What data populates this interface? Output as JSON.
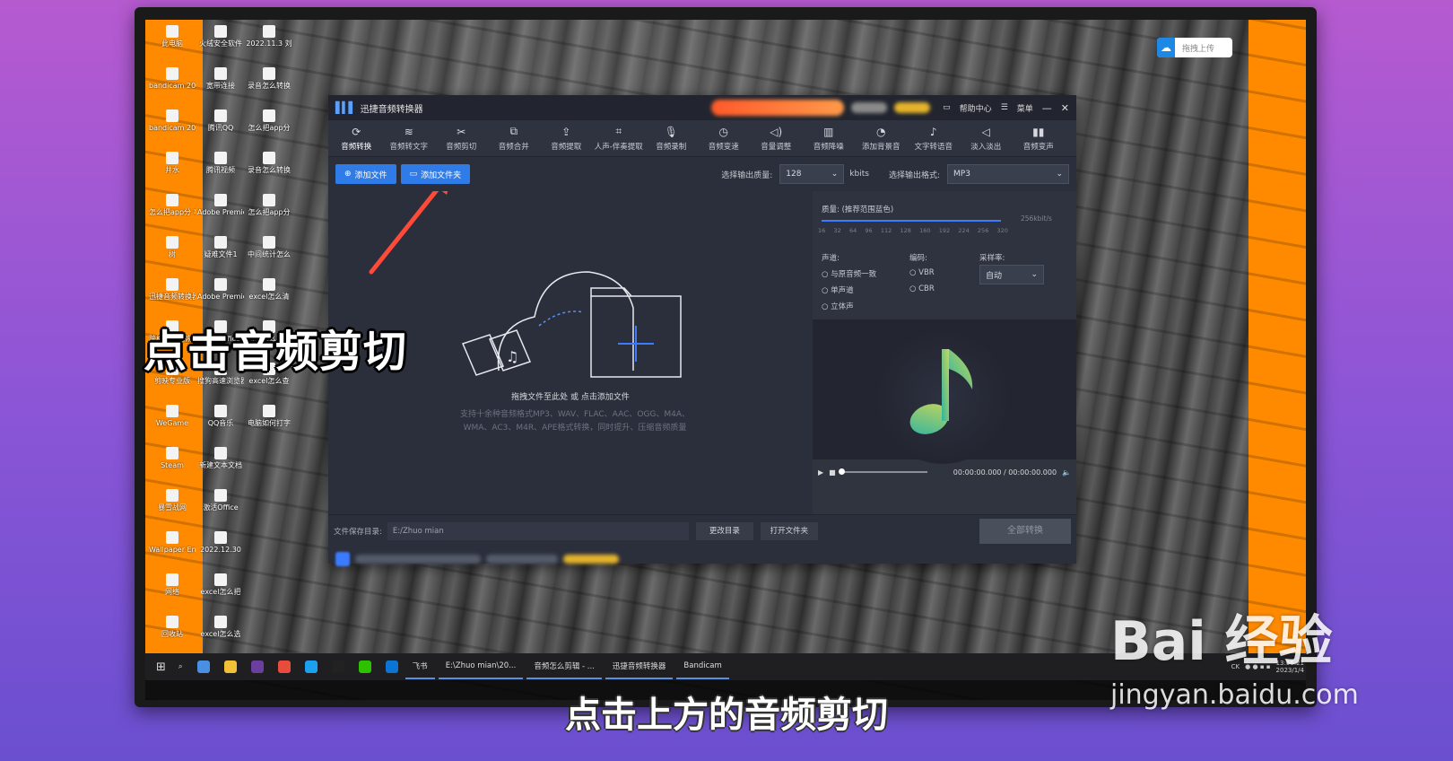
{
  "desktop": {
    "icons": [
      {
        "label": "此电脑"
      },
      {
        "label": "火绒安全软件"
      },
      {
        "label": "2022.11.3 刘"
      },
      {
        "label": "bandicam 2023-01-0..."
      },
      {
        "label": "宽带连接"
      },
      {
        "label": "录音怎么转换"
      },
      {
        "label": "bandicam 2023-01-0..."
      },
      {
        "label": "腾讯QQ"
      },
      {
        "label": "怎么把app分"
      },
      {
        "label": "井水"
      },
      {
        "label": "腾讯视频"
      },
      {
        "label": "录音怎么转换"
      },
      {
        "label": "怎么把app分 享给别人"
      },
      {
        "label": "Adobe Premiere P..."
      },
      {
        "label": "怎么把app分"
      },
      {
        "label": "树"
      },
      {
        "label": "疑难文件1"
      },
      {
        "label": "中间统计怎么"
      },
      {
        "label": "迅捷音频转换器"
      },
      {
        "label": "Adobe Premie..."
      },
      {
        "label": "excel怎么清"
      },
      {
        "label": "跨格式数据恢复大师"
      },
      {
        "label": "WPS Office"
      },
      {
        "label": "音频怎么剪辑"
      },
      {
        "label": "剪映专业版"
      },
      {
        "label": "搜狗高速浏览器"
      },
      {
        "label": "excel怎么查"
      },
      {
        "label": "WeGame"
      },
      {
        "label": "QQ音乐"
      },
      {
        "label": "电脑如何打字"
      },
      {
        "label": "Steam"
      },
      {
        "label": "新建文本文档"
      },
      {
        "label": ""
      },
      {
        "label": "暴雪战网"
      },
      {
        "label": "激活Office"
      },
      {
        "label": ""
      },
      {
        "label": "Wallpaper Engine: ..."
      },
      {
        "label": "2022.12.30"
      },
      {
        "label": ""
      },
      {
        "label": "网络"
      },
      {
        "label": "excel怎么把"
      },
      {
        "label": ""
      },
      {
        "label": "回收站"
      },
      {
        "label": "excel怎么选"
      },
      {
        "label": ""
      }
    ],
    "upload_pill": "拖拽上传"
  },
  "app": {
    "title": "迅捷音频转换器",
    "help": "帮助中心",
    "menu": "菜单",
    "toolbar": [
      {
        "label": "音频转换",
        "icon": "convert-icon"
      },
      {
        "label": "音频转文字",
        "icon": "audio-to-text-icon"
      },
      {
        "label": "音频剪切",
        "icon": "scissors-icon"
      },
      {
        "label": "音频合并",
        "icon": "merge-icon"
      },
      {
        "label": "音频提取",
        "icon": "extract-icon"
      },
      {
        "label": "人声-伴奏提取",
        "icon": "vocal-icon"
      },
      {
        "label": "音频录制",
        "icon": "mic-icon"
      },
      {
        "label": "音频变速",
        "icon": "speed-icon"
      },
      {
        "label": "音量调整",
        "icon": "volume-icon"
      },
      {
        "label": "音频降噪",
        "icon": "denoise-icon"
      },
      {
        "label": "添加背景音",
        "icon": "bg-music-icon"
      },
      {
        "label": "文字转语音",
        "icon": "tts-icon"
      },
      {
        "label": "淡入淡出",
        "icon": "fade-icon"
      },
      {
        "label": "音频变声",
        "icon": "voice-change-icon"
      }
    ],
    "add_file": "添加文件",
    "add_folder": "添加文件夹",
    "quality_label": "选择输出质量:",
    "quality_value": "128",
    "quality_unit": "kbits",
    "format_label": "选择输出格式:",
    "format_value": "MP3",
    "drop_hint": "拖拽文件至此处 或 点击添加文件",
    "drop_sub1": "支持十余种音频格式MP3、WAV、FLAC、AAC、OGG、M4A、",
    "drop_sub2": "WMA、AC3、M4R、APE格式转换，同时提升、压缩音频质量",
    "settings": {
      "quality_title": "质量: (推荐范围蓝色)",
      "quality_max": "256kbit/s",
      "ticks": [
        "16",
        "32",
        "64",
        "96",
        "112",
        "128",
        "160",
        "192",
        "224",
        "256",
        "320"
      ],
      "channel_title": "声道:",
      "channels": [
        "与原音频一致",
        "单声道",
        "立体声"
      ],
      "encoding_title": "编码:",
      "encodings": [
        "VBR",
        "CBR"
      ],
      "sample_title": "采样率:",
      "sample_value": "自动"
    },
    "time_display": "00:00:00.000 / 00:00:00.000",
    "save_label": "文件保存目录:",
    "save_path": "E:/Zhuo mian",
    "change_dir": "更改目录",
    "open_folder": "打开文件夹",
    "convert_all": "全部转换"
  },
  "taskbar": {
    "tasks": [
      "飞书",
      "E:\\Zhuo mian\\20...",
      "音频怎么剪辑 - ...",
      "迅捷音频转换器",
      "Bandicam"
    ],
    "tray_lang": "CK",
    "clock_time": "13:56:21",
    "clock_date": "2023/1/4"
  },
  "overlay": {
    "caption": "点击音频剪切",
    "subtitle": "点击上方的音频剪切",
    "watermark_logo": "Bai 经验",
    "watermark_url": "jingyan.baidu.com"
  },
  "colors": {
    "accent": "#2f7be8",
    "desktop_orange": "#ff8a00",
    "arrow": "#ff4a3a"
  }
}
